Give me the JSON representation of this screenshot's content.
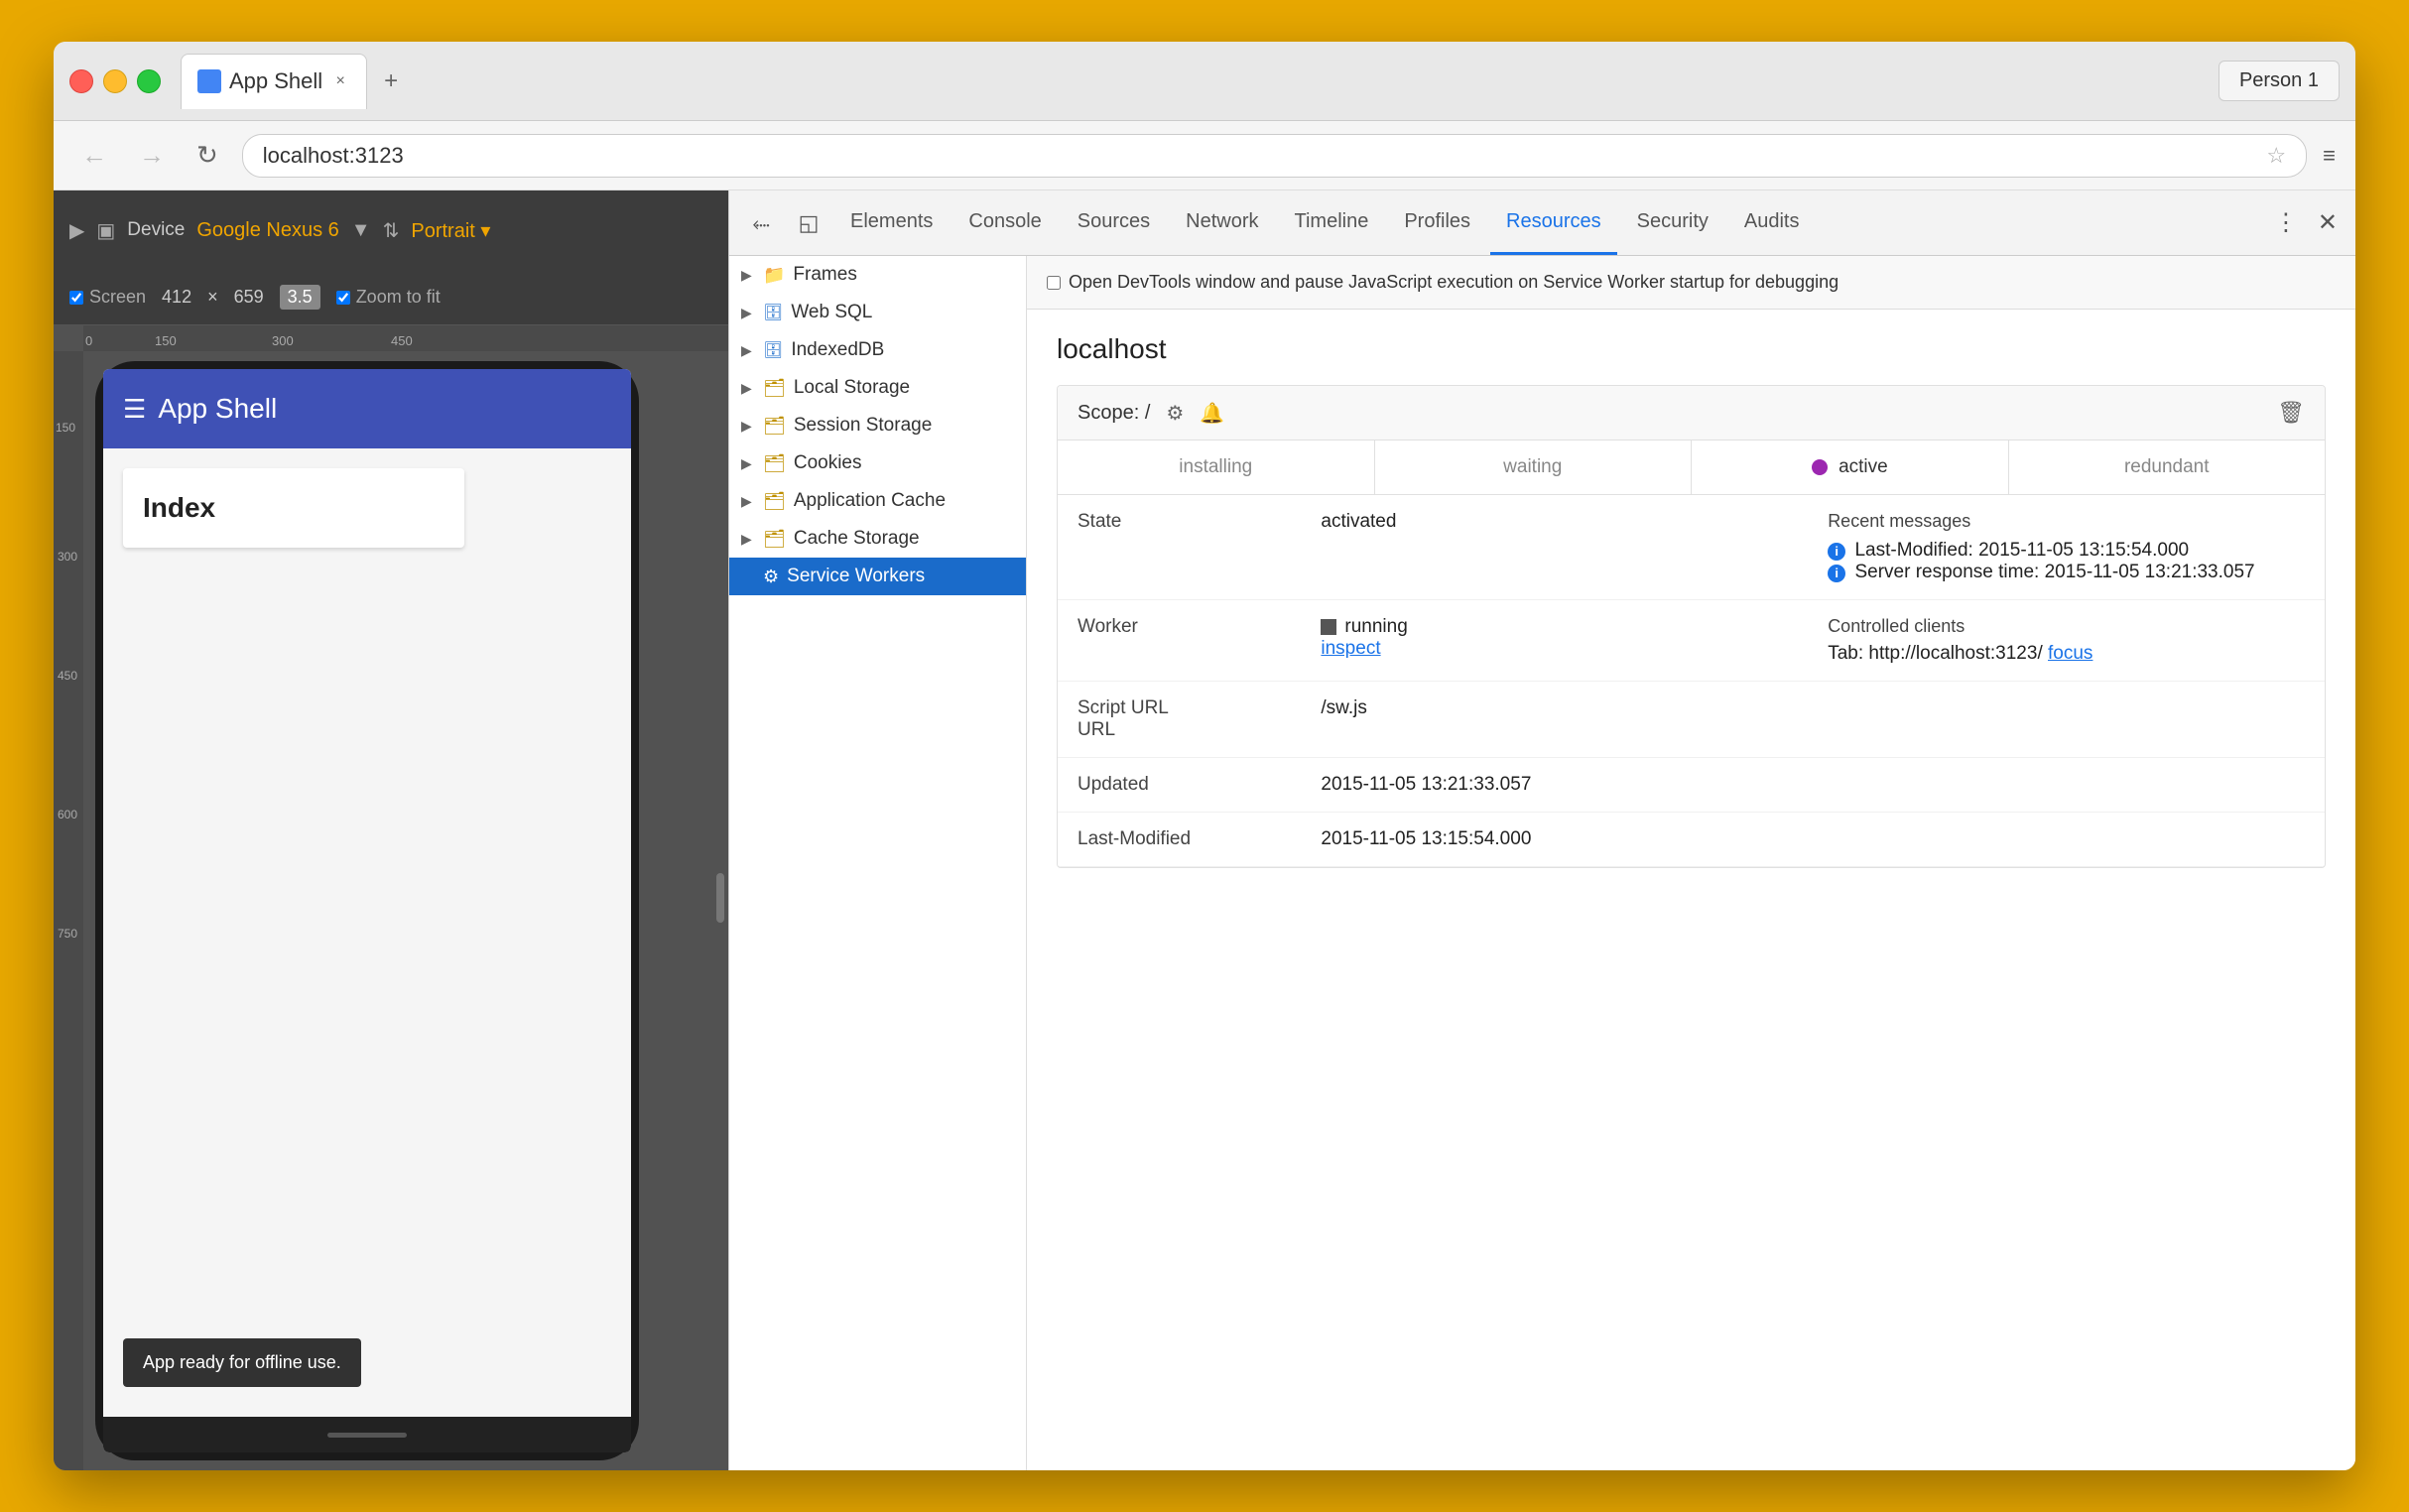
{
  "browser": {
    "tab_title": "App Shell",
    "tab_close": "×",
    "new_tab": "+",
    "profile_label": "Person 1",
    "url": "localhost:3123",
    "back_disabled": true,
    "forward_disabled": true
  },
  "device_toolbar": {
    "device_label": "Device",
    "device_name": "Google Nexus 6",
    "orientation": "Portrait ▾",
    "screen_label": "Screen",
    "screen_width": "412",
    "screen_x": "×",
    "screen_height": "659",
    "zoom_level": "3.5",
    "zoom_to_fit": "Zoom to fit"
  },
  "app_preview": {
    "header_title": "App Shell",
    "index_card": "Index",
    "offline_toast": "App ready for offline use."
  },
  "devtools": {
    "tabs": [
      {
        "label": "Elements"
      },
      {
        "label": "Console"
      },
      {
        "label": "Sources"
      },
      {
        "label": "Network"
      },
      {
        "label": "Timeline"
      },
      {
        "label": "Profiles"
      },
      {
        "label": "Resources",
        "active": true
      },
      {
        "label": "Security"
      },
      {
        "label": "Audits"
      }
    ],
    "sidebar": {
      "items": [
        {
          "label": "Frames",
          "type": "folder",
          "expandable": true
        },
        {
          "label": "Web SQL",
          "type": "db",
          "expandable": true
        },
        {
          "label": "IndexedDB",
          "type": "db",
          "expandable": true
        },
        {
          "label": "Local Storage",
          "type": "folder",
          "expandable": true
        },
        {
          "label": "Session Storage",
          "type": "folder",
          "expandable": true
        },
        {
          "label": "Cookies",
          "type": "folder",
          "expandable": true
        },
        {
          "label": "Application Cache",
          "type": "folder",
          "expandable": true
        },
        {
          "label": "Cache Storage",
          "type": "folder",
          "expandable": true
        },
        {
          "label": "Service Workers",
          "type": "sw",
          "expandable": false,
          "selected": true
        }
      ]
    },
    "sw_debug_label": "Open DevTools window and pause JavaScript execution on Service Worker startup for debugging",
    "localhost_title": "localhost",
    "sw": {
      "scope": "Scope: /",
      "status_tabs": [
        "installing",
        "waiting",
        "active",
        "redundant"
      ],
      "active_tab": "active",
      "state_label": "State",
      "state_value": "activated",
      "worker_label": "Worker",
      "worker_status": "running",
      "worker_inspect": "inspect",
      "recent_messages_title": "Recent messages",
      "message1": "Last-Modified: 2015-11-05 13:15:54.000",
      "message2": "Server response time: 2015-11-05 13:21:33.057",
      "controlled_clients_title": "Controlled clients",
      "controlled_client": "Tab: http://localhost:3123/",
      "focus_label": "focus",
      "script_url_label": "Script URL",
      "script_url_value": "/sw.js",
      "updated_label": "Updated",
      "updated_value": "2015-11-05 13:21:33.057",
      "last_modified_label": "Last-Modified",
      "last_modified_value": "2015-11-05 13:15:54.000"
    }
  }
}
